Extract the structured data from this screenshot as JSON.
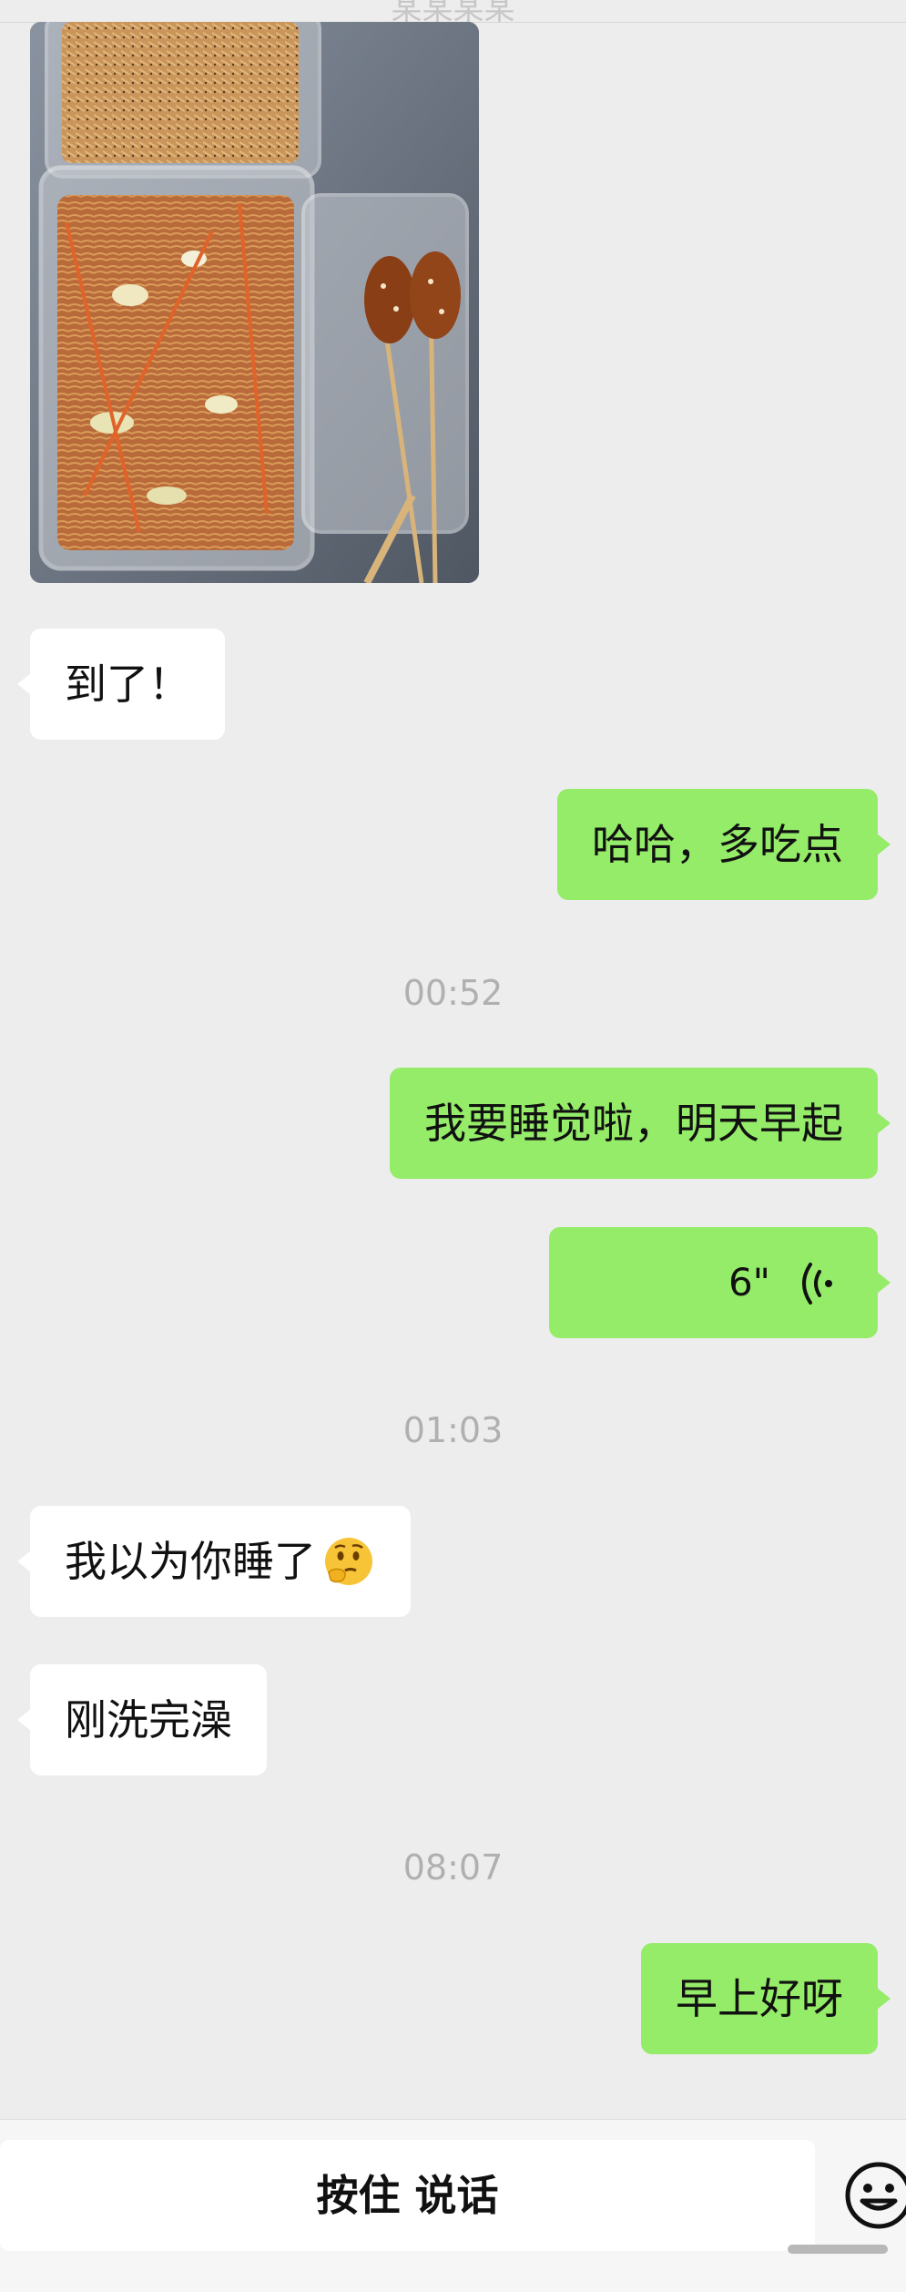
{
  "header": {
    "title": "某某某某"
  },
  "messages": [
    {
      "type": "image",
      "direction": "in",
      "description_icon": "food-photo"
    },
    {
      "type": "text",
      "direction": "in",
      "text": "到了！"
    },
    {
      "type": "text",
      "direction": "out",
      "text": "哈哈，多吃点"
    },
    {
      "type": "time",
      "text": "00:52"
    },
    {
      "type": "text",
      "direction": "out",
      "text": "我要睡觉啦，明天早起"
    },
    {
      "type": "voice",
      "direction": "out",
      "duration": "6\""
    },
    {
      "type": "time",
      "text": "01:03"
    },
    {
      "type": "text",
      "direction": "in",
      "text": "我以为你睡了",
      "emoji": "thinking-face-icon"
    },
    {
      "type": "text",
      "direction": "in",
      "text": "刚洗完澡"
    },
    {
      "type": "time",
      "text": "08:07"
    },
    {
      "type": "text",
      "direction": "out",
      "text": "早上好呀"
    }
  ],
  "input_bar": {
    "hold_to_talk": "按住 说话",
    "emoji_icon": "smiley-icon"
  },
  "colors": {
    "background": "#ededed",
    "bubble_out": "#95ec69",
    "bubble_in": "#ffffff",
    "timestamp": "#b0b0b0"
  }
}
